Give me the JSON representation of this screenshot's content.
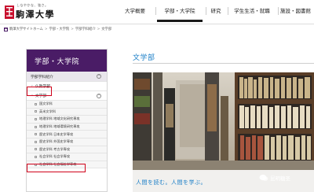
{
  "logo": {
    "tagline": "しなやかな、強さ。",
    "name": "駒澤大學"
  },
  "nav": {
    "items": [
      {
        "label": "大学概要"
      },
      {
        "label": "学部・大学院",
        "active": true
      },
      {
        "label": "研究"
      },
      {
        "label": "学生生活・就職"
      },
      {
        "label": "施設・図書館"
      }
    ]
  },
  "breadcrumb": [
    "駒澤大学サイトホーム",
    "学部・大学院",
    "学部学科紹介",
    "文学部"
  ],
  "sidebar": {
    "title": "学部・大学院",
    "section": "学部学科紹介",
    "items": [
      {
        "label": "仏教学部"
      },
      {
        "label": "文学部"
      }
    ],
    "subitems": [
      "国文学科",
      "英米文学科",
      "地理学科 地域文化研究専攻",
      "地理学科 地域環境研究専攻",
      "歴史学科 日本史学専攻",
      "歴史学科 外国史学専攻",
      "歴史学科 考古学専攻",
      "社会学科 社会学専攻",
      "社会学科 社会福祉学専攻"
    ]
  },
  "main": {
    "title": "文学部",
    "hero_caption": "人間を読む。人間を学ぶ。"
  },
  "watermark": "昆明糖圣",
  "colors": {
    "brand_purple": "#4a1c66",
    "accent_blue": "#1a7ec7",
    "highlight_red": "#d0021b",
    "logo_red": "#c8102e"
  }
}
